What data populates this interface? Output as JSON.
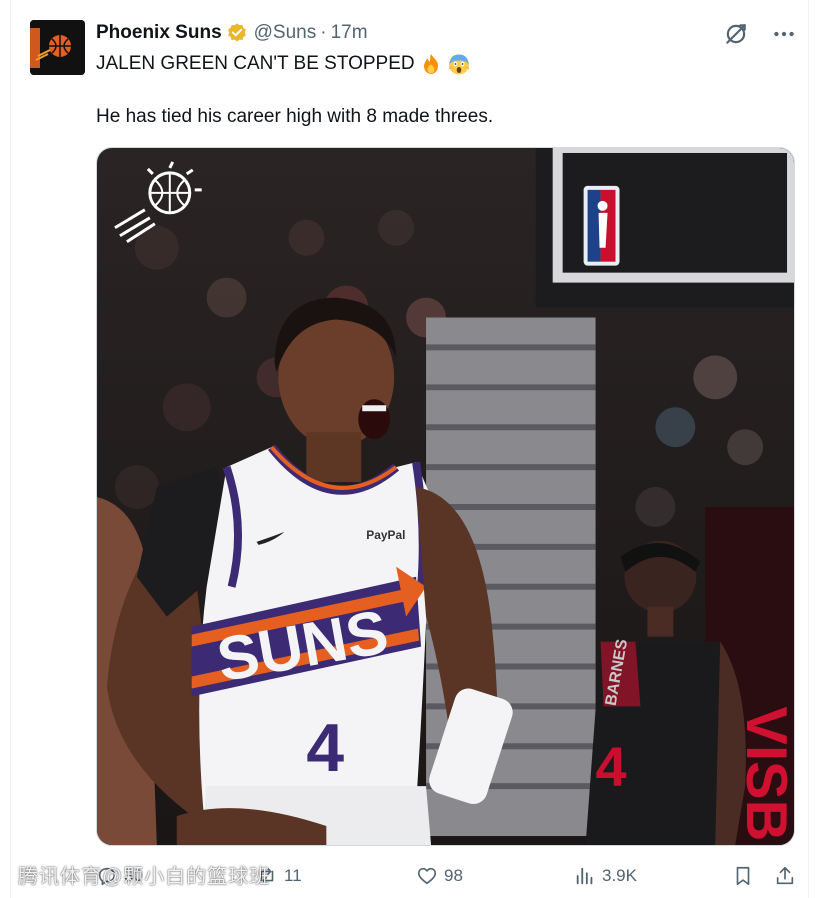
{
  "tweet": {
    "author_name": "Phoenix Suns",
    "handle": "@Suns",
    "separator": "·",
    "time": "17m",
    "text_line1": "JALEN GREEN CAN'T BE STOPPED",
    "text_line2": "He has tied his career high with 8 made threes.",
    "emojis": [
      "fire-emoji",
      "screaming-face-emoji"
    ]
  },
  "media": {
    "jersey_text": "SUNS",
    "jersey_number": "4",
    "sponsor": "PayPal",
    "opponent_jersey_number": "4",
    "opponent_name": "BARNES",
    "banner_text": "VISB"
  },
  "actions": {
    "replies": "30",
    "retweets": "11",
    "likes": "98",
    "views": "3.9K"
  },
  "watermark": "腾讯体育@颗小白的篮球班",
  "colors": {
    "text_primary": "#0f1419",
    "text_secondary": "#536471",
    "verified_gold": "#e8b829",
    "suns_purple": "#3c2a74",
    "suns_orange": "#e56020"
  }
}
